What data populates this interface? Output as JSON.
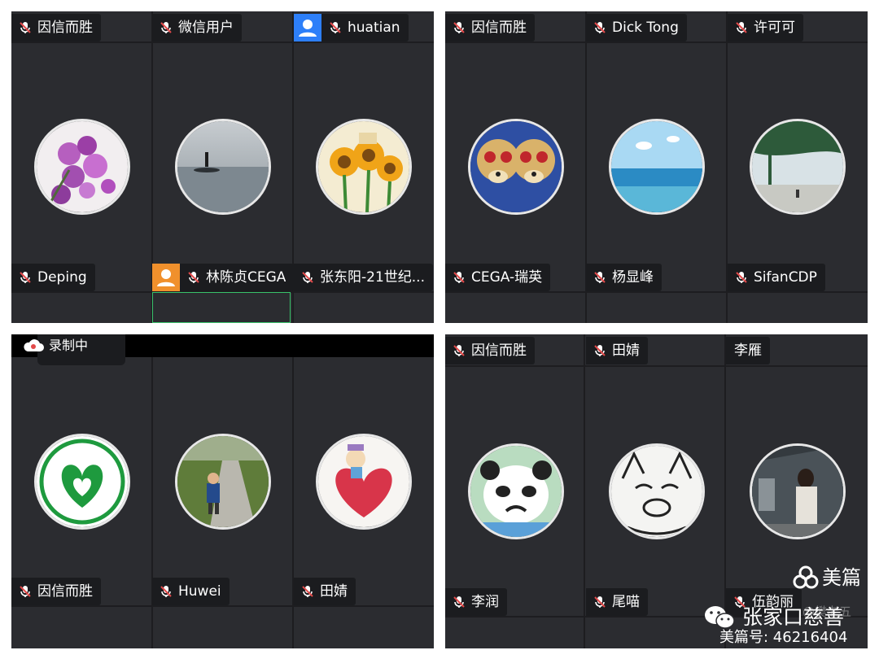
{
  "panels": {
    "p1": {
      "top": [
        "因信而胜",
        "微信用户",
        "huatian"
      ],
      "bottom": [
        "Deping",
        "林陈贞CEGA",
        "张东阳-21世纪..."
      ]
    },
    "p2": {
      "top": [
        "因信而胜",
        "Dick Tong",
        "许可可"
      ],
      "bottom": [
        "CEGA-瑞英",
        "杨显峰",
        "SifanCDP"
      ]
    },
    "p3": {
      "recording": "录制中",
      "bottom": [
        "因信而胜",
        "Huwei",
        "田婧"
      ]
    },
    "p4": {
      "top": [
        "因信而胜",
        "田婧",
        "李雁"
      ],
      "bottom": [
        "李润",
        "尾喵",
        "伍韵丽"
      ]
    }
  },
  "watermark": {
    "brand": "美篇",
    "author": "张家口慈善",
    "id": "美篇号: 46216404",
    "faint": "@樊老五"
  },
  "colors": {
    "panel_bg": "#2b2c30",
    "tag_bg": "#1b1c1f",
    "mic_muted": "#e24a4a",
    "badge_blue": "#2d7ff9",
    "badge_orange": "#f0902c",
    "active_border": "#39c26a"
  }
}
